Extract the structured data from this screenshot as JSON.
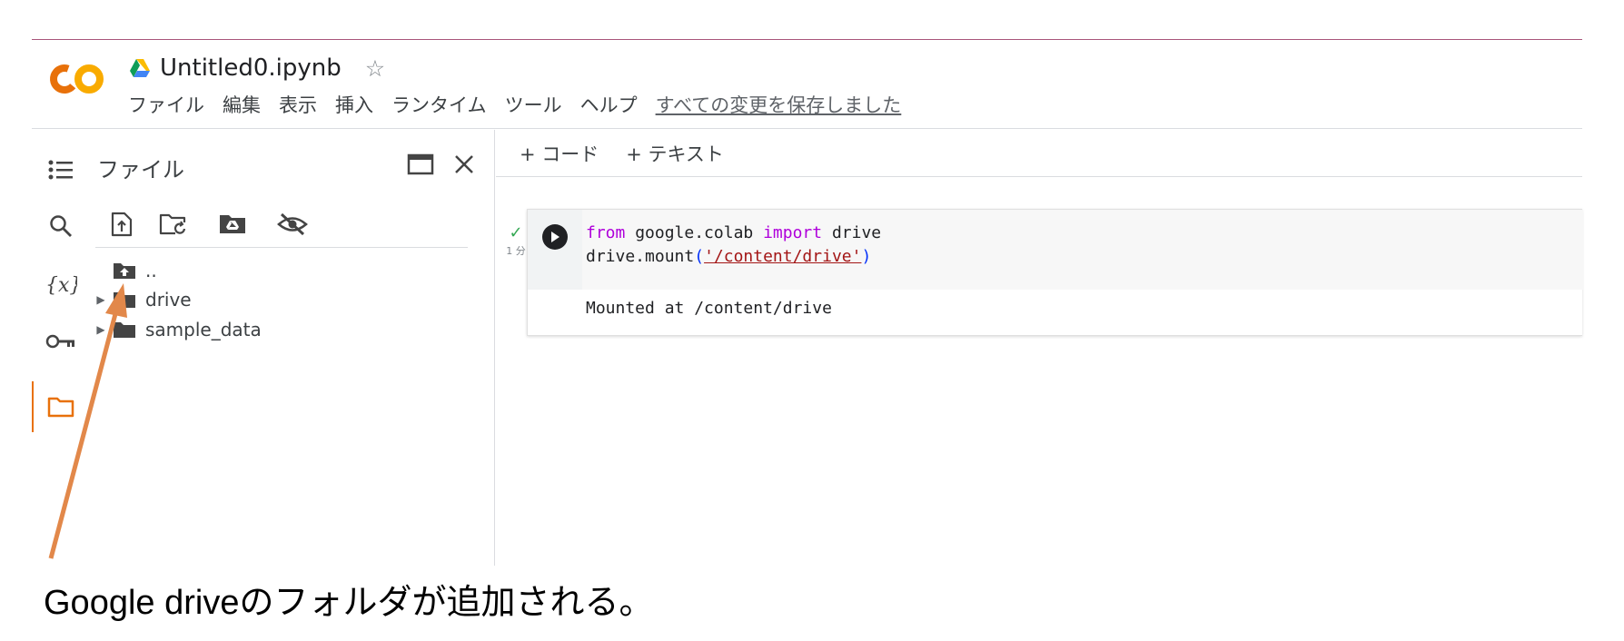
{
  "notebook": {
    "title": "Untitled0.ipynb",
    "menu": [
      "ファイル",
      "編集",
      "表示",
      "挿入",
      "ランタイム",
      "ツール",
      "ヘルプ"
    ],
    "save_status": "すべての変更を保存しました"
  },
  "sidebar": {
    "panel_title": "ファイル",
    "tree": [
      {
        "label": ".."
      },
      {
        "label": "drive"
      },
      {
        "label": "sample_data"
      }
    ]
  },
  "main": {
    "add_code": "+ コード",
    "add_text": "+ テキスト",
    "cell": {
      "exec_time": "1 分",
      "code_line1": {
        "kw_from": "from",
        "mod": " google.colab ",
        "kw_import": "import",
        "name": " drive"
      },
      "code_line2": {
        "prefix": "drive.mount",
        "open": "(",
        "string": "'/content/drive'",
        "close": ")"
      },
      "output": "Mounted at /content/drive"
    }
  },
  "annotation": {
    "text": "Google driveのフォルダが追加される。"
  },
  "colors": {
    "accent": "#e8710a",
    "keyword": "#af00db",
    "string": "#a31515",
    "arrow": "#e2884a"
  },
  "icons": [
    "colab-logo",
    "drive-icon",
    "star-icon",
    "toc-icon",
    "search-icon",
    "variables-icon",
    "key-icon",
    "folder-icon",
    "new-window-icon",
    "close-icon",
    "upload-file-icon",
    "refresh-folder-icon",
    "mount-drive-icon",
    "hide-icon",
    "play-icon",
    "check-icon"
  ]
}
